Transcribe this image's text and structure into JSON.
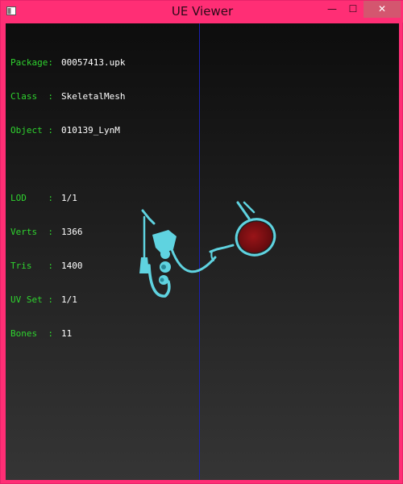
{
  "window": {
    "title": "UE Viewer"
  },
  "controls": {
    "minimize": "—",
    "maximize": "☐",
    "close": "✕"
  },
  "info": {
    "package": {
      "label": "Package:",
      "value": "00057413.upk"
    },
    "class": {
      "label": "Class  :",
      "value": "SkeletalMesh"
    },
    "object": {
      "label": "Object :",
      "value": "010139_LynM"
    },
    "lod": {
      "label": "LOD    :",
      "value": "1/1"
    },
    "verts": {
      "label": "Verts  :",
      "value": "1366"
    },
    "tris": {
      "label": "Tris   :",
      "value": "1400"
    },
    "uvset": {
      "label": "UV Set :",
      "value": "1/1"
    },
    "bones": {
      "label": "Bones  :",
      "value": "11"
    }
  },
  "colors": {
    "titlebar": "#ff2e75",
    "label_green": "#2fd42f",
    "axis_blue": "#1a1fb3",
    "mesh_cyan": "#5fd3e0",
    "lens_red": "#8b0f14"
  }
}
